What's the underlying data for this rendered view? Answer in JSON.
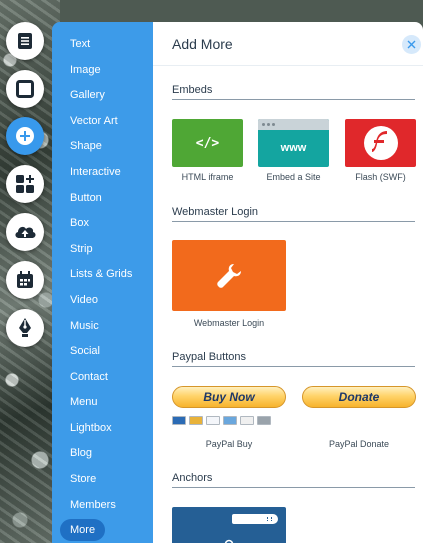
{
  "colors": {
    "category_panel": "#3d9be9",
    "category_selected": "#1f70c4",
    "accent_blue": "#3899ec",
    "html_iframe_tile": "#4fa735",
    "embed_site_tile": "#14a5a0",
    "flash_tile": "#e0282b",
    "webmaster_tile": "#f26a1c",
    "anchor_tile": "#255f95"
  },
  "toolbar": [
    {
      "icon": "pages-menu-icon",
      "active": false
    },
    {
      "icon": "background-icon",
      "active": false
    },
    {
      "icon": "add-icon",
      "active": true
    },
    {
      "icon": "add-apps-icon",
      "active": false
    },
    {
      "icon": "upload-cloud-icon",
      "active": false
    },
    {
      "icon": "blog-calendar-icon",
      "active": false
    },
    {
      "icon": "pen-nib-icon",
      "active": false
    }
  ],
  "categories": {
    "text": "Text",
    "image": "Image",
    "gallery": "Gallery",
    "vector_art": "Vector Art",
    "shape": "Shape",
    "interactive": "Interactive",
    "button": "Button",
    "box": "Box",
    "strip": "Strip",
    "lists_grids": "Lists & Grids",
    "video": "Video",
    "music": "Music",
    "social": "Social",
    "contact": "Contact",
    "menu": "Menu",
    "lightbox": "Lightbox",
    "blog": "Blog",
    "store": "Store",
    "members": "Members",
    "more": "More",
    "selected": "More"
  },
  "panel": {
    "title": "Add More",
    "sections": {
      "embeds": "Embeds",
      "webmaster_login": "Webmaster Login",
      "paypal_buttons": "Paypal Buttons",
      "anchors": "Anchors"
    },
    "embeds": {
      "html_iframe": {
        "label": "HTML iframe",
        "glyph": "</>"
      },
      "embed_site": {
        "label": "Embed a Site",
        "glyph": "www"
      },
      "flash": {
        "label": "Flash (SWF)"
      }
    },
    "webmaster": {
      "label": "Webmaster Login"
    },
    "paypal": {
      "buy_button_text": "Buy Now",
      "buy_label": "PayPal Buy",
      "donate_button_text": "Donate",
      "donate_label": "PayPal Donate",
      "card_icons": [
        "maestro",
        "mastercard",
        "visa",
        "amex",
        "discover",
        "bank"
      ]
    }
  }
}
